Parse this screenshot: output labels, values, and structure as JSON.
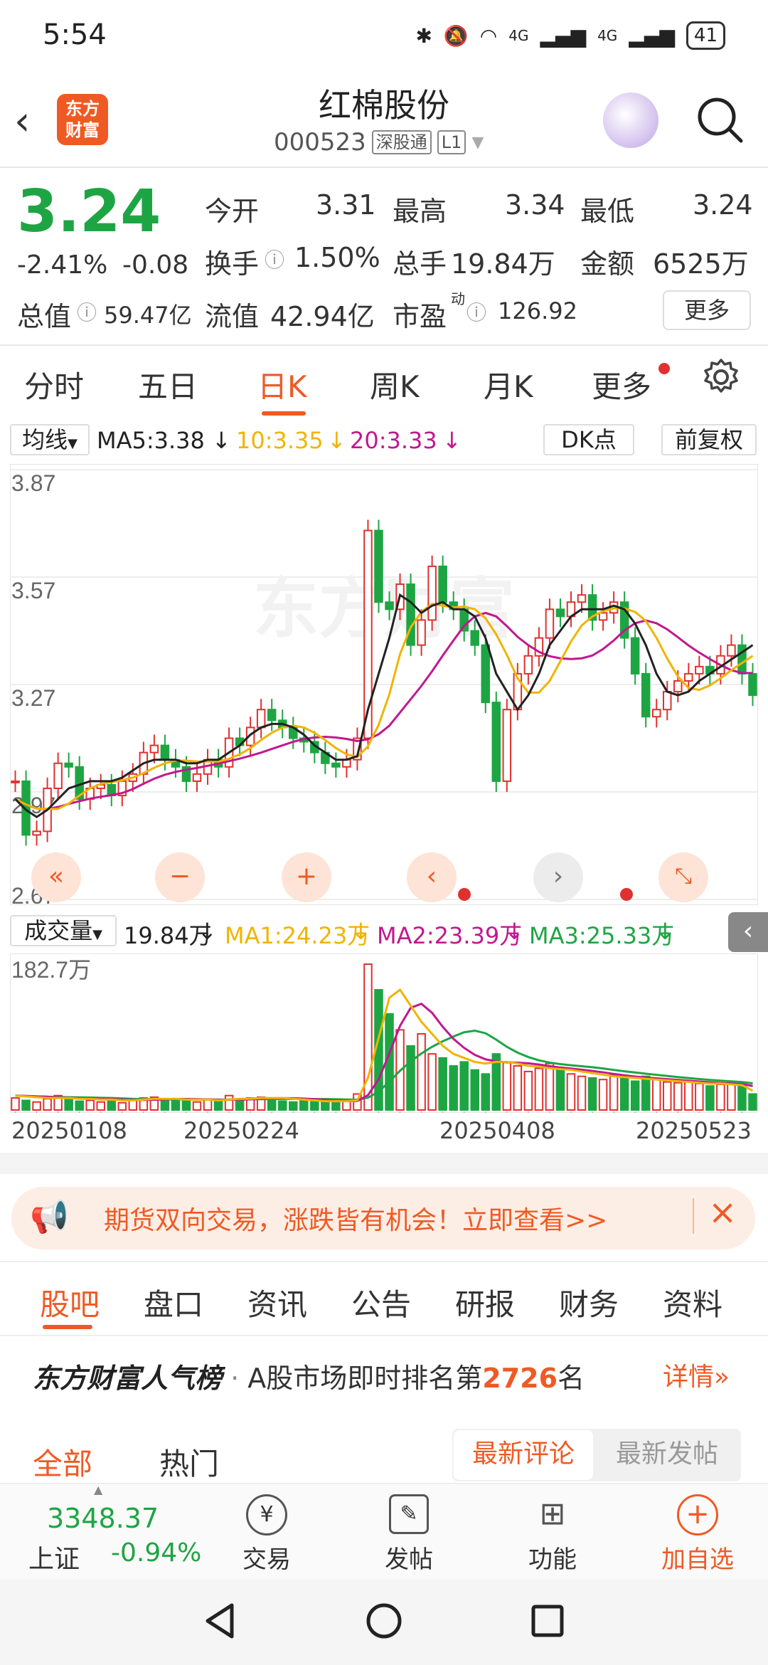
{
  "status": {
    "time": "5:54",
    "network_a": "4G",
    "network_b": "4G",
    "battery": "41"
  },
  "header": {
    "logo_line1": "东方",
    "logo_line2": "财富",
    "title": "红棉股份",
    "code": "000523",
    "tag1": "深股通",
    "tag2": "L1"
  },
  "quote": {
    "price": "3.24",
    "pct": "-2.41%",
    "chg": "-0.08",
    "open_label": "今开",
    "open": "3.31",
    "high_label": "最高",
    "high": "3.34",
    "low_label": "最低",
    "low": "3.24",
    "turnover_label": "换手",
    "turnover": "1.50%",
    "vol_label": "总手",
    "vol": "19.84万",
    "amount_label": "金额",
    "amount": "6525万",
    "mktcap_label": "总值",
    "mktcap": "59.47亿",
    "float_label": "流值",
    "float": "42.94亿",
    "pe_label": "市盈",
    "pe_sup": "动",
    "pe": "126.92",
    "more": "更多"
  },
  "tabs": [
    "分时",
    "五日",
    "日K",
    "周K",
    "月K",
    "更多"
  ],
  "chart_header": {
    "ma_sel": "均线",
    "ma5": "MA5:3.38",
    "ma10": "10:3.35",
    "ma20": "20:3.33",
    "dk": "DK点",
    "fq": "前复权"
  },
  "chart_data": {
    "type": "candlestick",
    "y_ticks": [
      "3.87",
      "3.57",
      "3.27",
      "2.97",
      "2.67"
    ],
    "ylim": [
      2.67,
      3.87
    ],
    "x_labels": [
      "20250108",
      "20250224",
      "20250408",
      "20250523"
    ],
    "watermark": "东方财富",
    "volume_label": "182.7万",
    "close": [
      3.0,
      2.85,
      2.86,
      2.98,
      3.05,
      3.04,
      2.95,
      2.98,
      2.99,
      2.96,
      3.0,
      3.02,
      3.08,
      3.1,
      3.06,
      3.04,
      3.0,
      3.02,
      3.06,
      3.04,
      3.12,
      3.1,
      3.15,
      3.2,
      3.17,
      3.15,
      3.12,
      3.11,
      3.08,
      3.05,
      3.04,
      3.06,
      3.12,
      3.7,
      3.5,
      3.48,
      3.55,
      3.38,
      3.45,
      3.6,
      3.5,
      3.48,
      3.42,
      3.38,
      3.22,
      3.0,
      3.2,
      3.3,
      3.35,
      3.4,
      3.48,
      3.46,
      3.5,
      3.52,
      3.45,
      3.47,
      3.5,
      3.4,
      3.3,
      3.18,
      3.2,
      3.25,
      3.28,
      3.3,
      3.32,
      3.3,
      3.35,
      3.38,
      3.3,
      3.24
    ],
    "ma5": [
      2.95,
      2.92,
      2.9,
      2.92,
      2.95,
      2.98,
      2.99,
      3.0,
      3.0,
      3.0,
      3.01,
      3.03,
      3.05,
      3.06,
      3.06,
      3.06,
      3.05,
      3.05,
      3.06,
      3.06,
      3.08,
      3.1,
      3.13,
      3.15,
      3.16,
      3.16,
      3.15,
      3.13,
      3.1,
      3.08,
      3.06,
      3.06,
      3.07,
      3.2,
      3.3,
      3.4,
      3.52,
      3.5,
      3.47,
      3.49,
      3.5,
      3.48,
      3.48,
      3.46,
      3.4,
      3.3,
      3.25,
      3.2,
      3.24,
      3.3,
      3.38,
      3.42,
      3.46,
      3.48,
      3.48,
      3.48,
      3.49,
      3.48,
      3.44,
      3.38,
      3.3,
      3.25,
      3.24,
      3.25,
      3.28,
      3.3,
      3.32,
      3.34,
      3.36,
      3.38
    ],
    "volume": [
      15,
      12,
      10,
      14,
      18,
      16,
      11,
      12,
      10,
      11,
      9,
      12,
      15,
      16,
      14,
      12,
      11,
      10,
      13,
      12,
      18,
      14,
      15,
      16,
      12,
      11,
      10,
      12,
      11,
      10,
      9,
      12,
      20,
      182,
      150,
      120,
      100,
      80,
      95,
      70,
      65,
      55,
      60,
      50,
      45,
      70,
      60,
      55,
      48,
      52,
      58,
      50,
      45,
      42,
      40,
      38,
      44,
      40,
      36,
      42,
      38,
      35,
      34,
      36,
      33,
      30,
      32,
      34,
      31,
      20
    ],
    "vol_ma1": [
      18,
      17,
      16,
      15,
      15,
      15,
      14,
      14,
      13,
      13,
      12,
      12,
      13,
      14,
      14,
      14,
      13,
      13,
      13,
      12,
      13,
      14,
      14,
      15,
      15,
      15,
      14,
      13,
      12,
      11,
      11,
      11,
      12,
      40,
      90,
      140,
      150,
      130,
      110,
      95,
      80,
      70,
      65,
      60,
      58,
      60,
      60,
      58,
      55,
      54,
      52,
      51,
      50,
      48,
      46,
      44,
      42,
      41,
      40,
      39,
      38,
      37,
      36,
      35,
      34,
      33,
      33,
      32,
      31,
      24
    ]
  },
  "vol_header": {
    "sel": "成交量",
    "vol": "19.84万",
    "ma1": "MA1:24.23万",
    "ma2": "MA2:23.39万",
    "ma3": "MA3:25.33万"
  },
  "banner": {
    "text": "期货双向交易，涨跌皆有机会！立即查看>>"
  },
  "bottom_tabs": [
    "股吧",
    "盘口",
    "资讯",
    "公告",
    "研报",
    "财务",
    "资料"
  ],
  "rank": {
    "brand": "东方财富人气榜",
    "dot": "·",
    "pre": "A股市场即时排名第",
    "num": "2726",
    "post": "名",
    "detail": "详情"
  },
  "filters": {
    "all": "全部",
    "hot": "热门",
    "latest_comment": "最新评论",
    "latest_post": "最新发帖"
  },
  "nav": {
    "index_val": "3348.37",
    "index_name": "上证",
    "index_pct": "-0.94%",
    "trade": "交易",
    "post": "发帖",
    "func": "功能",
    "add": "加自选"
  },
  "colors": {
    "up": "#e0312f",
    "down": "#1ea543",
    "accent": "#ef5a24",
    "ma5": "#222222",
    "ma10": "#f0b400",
    "ma20": "#c1188f"
  }
}
